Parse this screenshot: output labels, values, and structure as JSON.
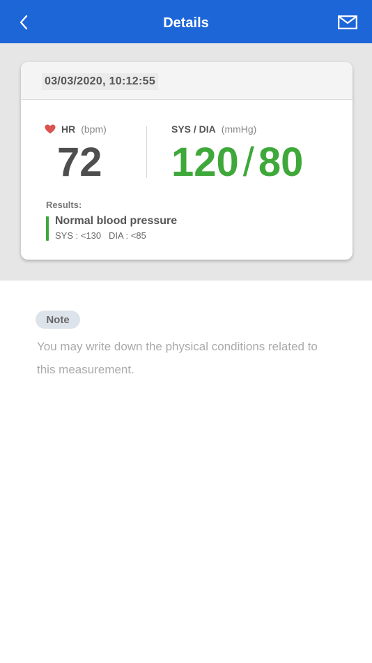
{
  "header": {
    "title": "Details",
    "back_icon": "chevron-left-icon",
    "mail_icon": "mail-icon",
    "background": "#1d66d8"
  },
  "card": {
    "timestamp": "03/03/2020, 10:12:55",
    "hr": {
      "label": "HR",
      "unit": "(bpm)",
      "value": "72",
      "icon": "heart-icon",
      "icon_color": "#d9534f"
    },
    "bp": {
      "label": "SYS / DIA",
      "unit": "(mmHg)",
      "sys": "120",
      "slash": "/",
      "dia": "80",
      "color": "#3fa83a"
    },
    "results": {
      "label": "Results:",
      "title": "Normal blood pressure",
      "range": "SYS : <130   DIA : <85"
    }
  },
  "note": {
    "label": "Note",
    "placeholder": "You may write down the physical conditions related to this measurement."
  }
}
